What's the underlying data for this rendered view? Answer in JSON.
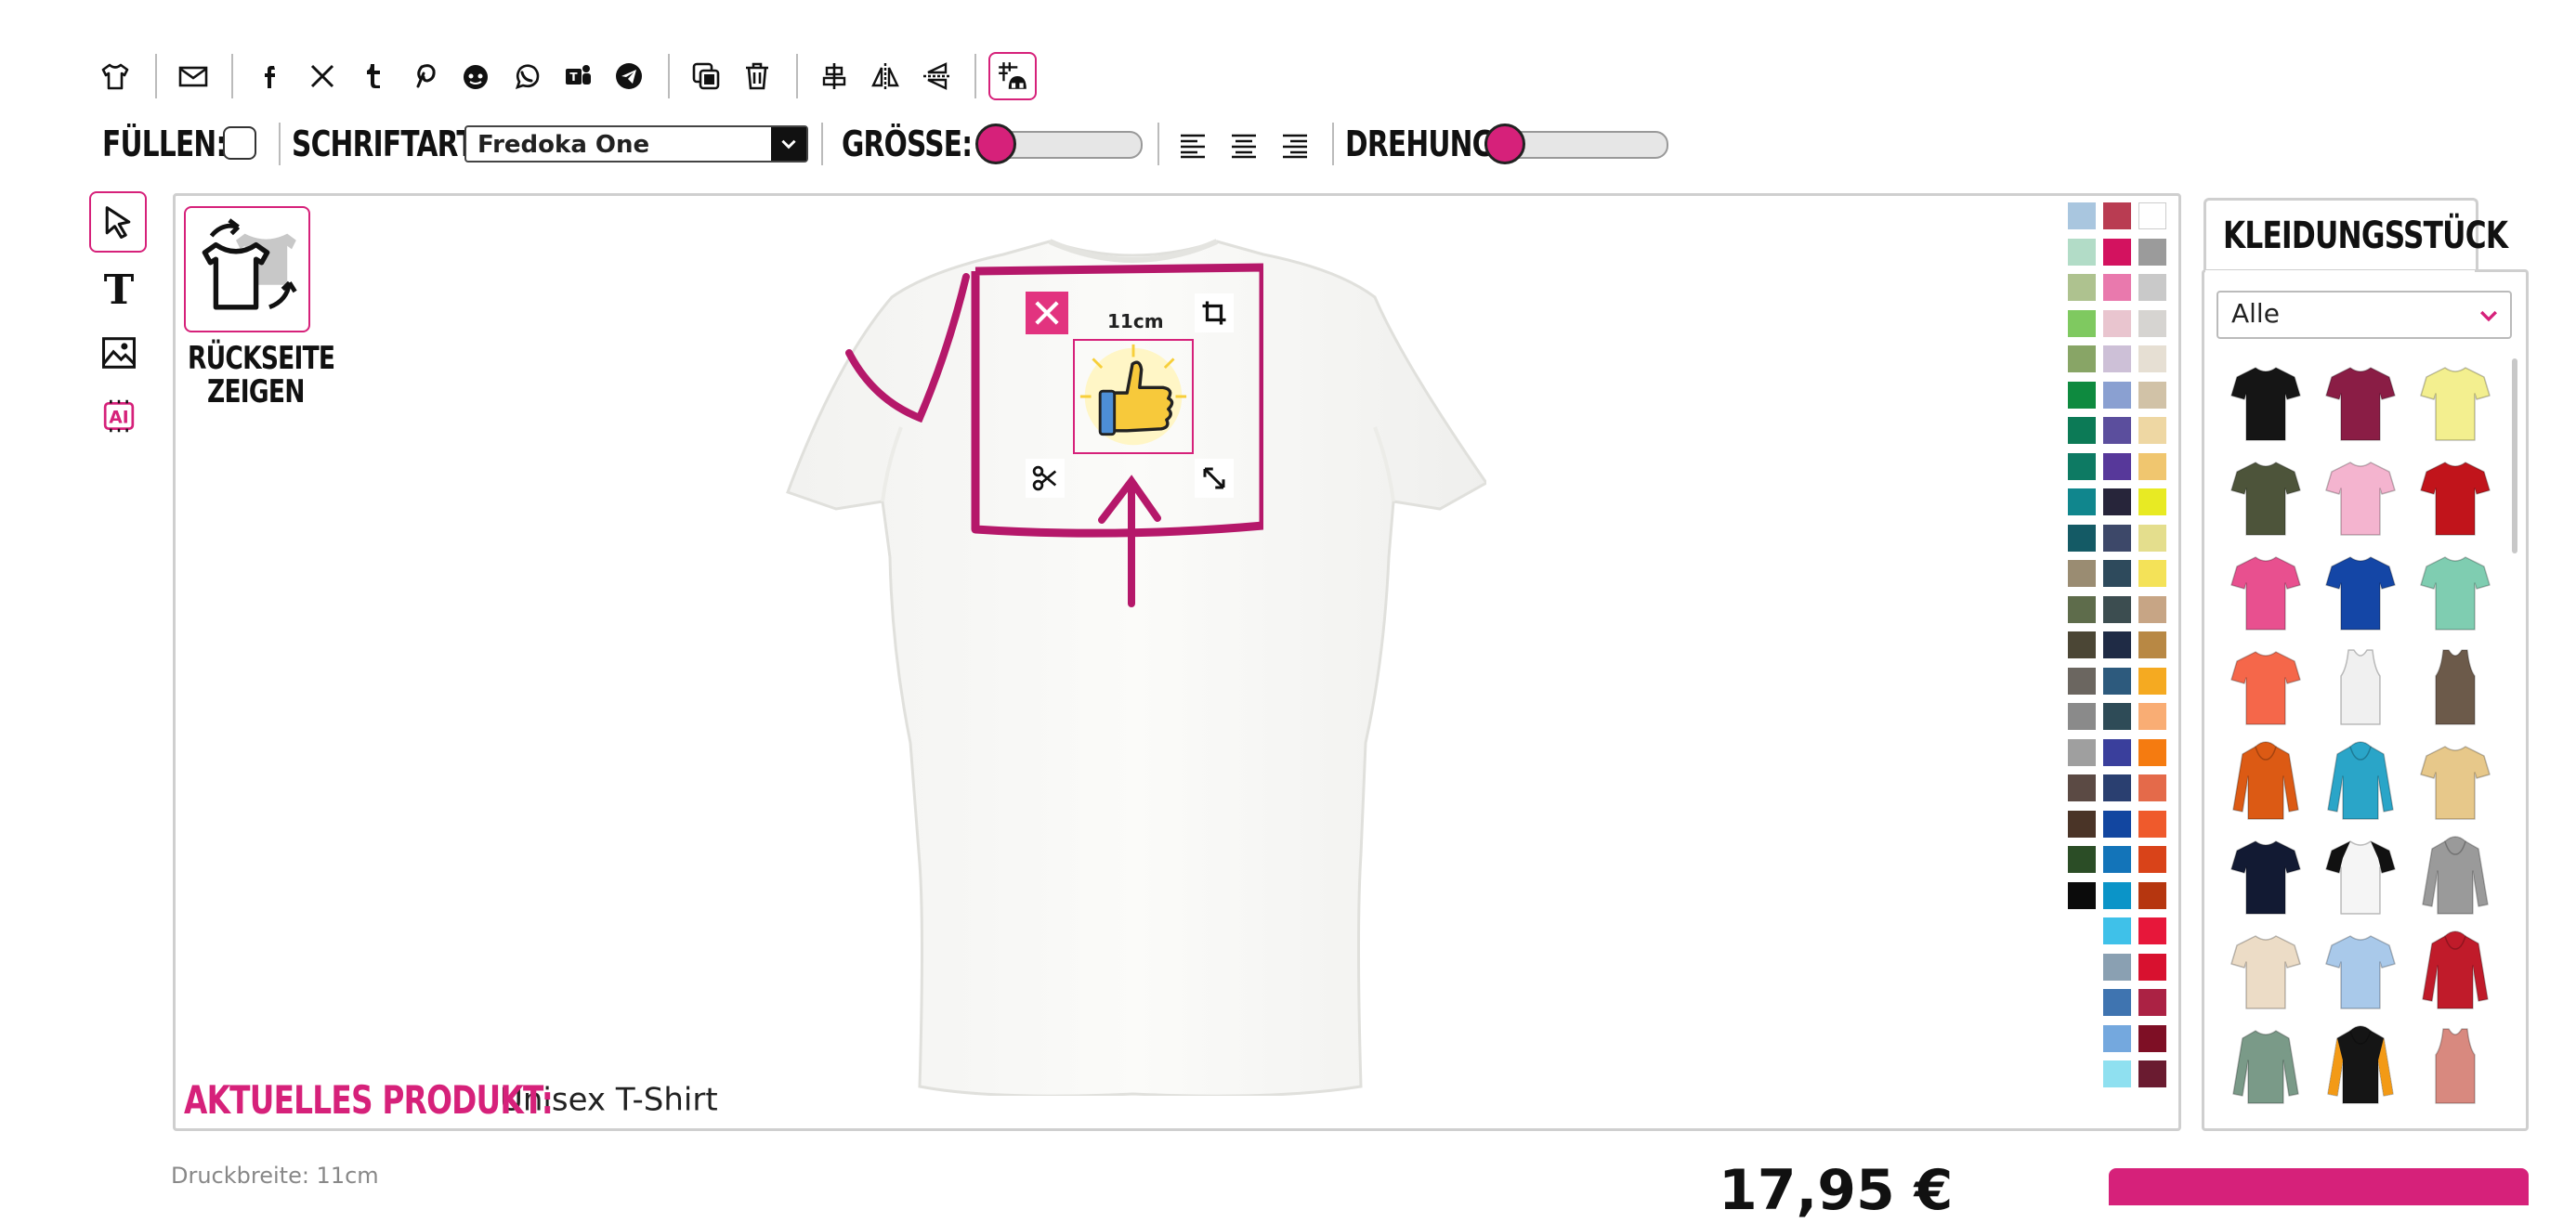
{
  "toolbar": {
    "icons": [
      "shirt-icon",
      "mail-icon",
      "facebook-icon",
      "x-icon",
      "tumblr-icon",
      "pinterest-icon",
      "reddit-icon",
      "whatsapp-icon",
      "teams-icon",
      "telegram-icon",
      "duplicate-icon",
      "delete-icon",
      "align-center-icon",
      "flip-horizontal-icon",
      "flip-vertical-icon",
      "grid-icon"
    ]
  },
  "options": {
    "fill_label": "FÜLLEN:",
    "font_label": "SCHRIFTART:",
    "font_value": "Fredoka One",
    "size_label": "GRÖSSE:",
    "size_level": 0.0,
    "rotation_label": "DREHUNG:",
    "rotation_level": 0.0
  },
  "tools": [
    "pointer-icon",
    "text-icon",
    "image-icon",
    "ai-icon"
  ],
  "back_side": {
    "line1": "RÜCKSEITE",
    "line2": "ZEIGEN"
  },
  "design": {
    "width_label": "11cm"
  },
  "current_product": {
    "label": "AKTUELLES PRODUKT:",
    "value": "Unisex T-Shirt"
  },
  "palette": {
    "col1": [
      "#a9c6df",
      "#b2dcc7",
      "#aec28f",
      "#7fc960",
      "#88a566",
      "#0e8a3f",
      "#0c7a56",
      "#0d7a63",
      "#10868d",
      "#145a65",
      "#9a8c72",
      "#5e6c4b",
      "#4b4635",
      "#6b6660",
      "#8a8a8a",
      "#9f9f9f",
      "#5b4a44",
      "#4a3427",
      "#2b4d26",
      "#0b0b0b"
    ],
    "col2": [
      "#b93c52",
      "#d3125f",
      "#e979ad",
      "#e9c5cf",
      "#cdc0d7",
      "#8aa0d1",
      "#5b4e9d",
      "#57389a",
      "#27253a",
      "#3d4869",
      "#2e4a5c",
      "#3c4d50",
      "#1f2b45",
      "#2d5a7d",
      "#2e4b57",
      "#3a3f9c",
      "#2a3f70",
      "#1246a0",
      "#1374b9",
      "#0b94c8",
      "#3fc1e9",
      "#8aa0b2",
      "#3f74b0",
      "#74a8de",
      "#8fe0f0"
    ],
    "col3": [
      "#ffffff",
      "#9b9b9b",
      "#c9c9c9",
      "#d6d4d1",
      "#e6dfd3",
      "#d1c2a7",
      "#eed7a3",
      "#f0c66f",
      "#e8ea23",
      "#e4de8d",
      "#f4e258",
      "#c7a585",
      "#b88844",
      "#f5aa21",
      "#f9ad74",
      "#f57b10",
      "#e46a4a",
      "#ef5a2c",
      "#d94319",
      "#b6360f",
      "#e7173a",
      "#d8112f",
      "#ab2244",
      "#7e0f25",
      "#6a1b30"
    ]
  },
  "garments": {
    "tab_label": "KLEIDUNGSSTÜCK",
    "filter_value": "Alle",
    "items": [
      {
        "name": "black-tshirt",
        "color": "#151515"
      },
      {
        "name": "burgundy-tshirt",
        "color": "#8a1d45"
      },
      {
        "name": "yellow-tshirt",
        "color": "#f3ef8f"
      },
      {
        "name": "olive-tshirt",
        "color": "#4d543a"
      },
      {
        "name": "light-pink-tshirt",
        "color": "#f4b4cf"
      },
      {
        "name": "red-tshirt",
        "color": "#c1141b"
      },
      {
        "name": "pink-tshirt",
        "color": "#e8508f"
      },
      {
        "name": "royal-blue-tshirt",
        "color": "#1446a6"
      },
      {
        "name": "mint-tshirt",
        "color": "#7fcdb1"
      },
      {
        "name": "coral-tshirt",
        "color": "#f5674a"
      },
      {
        "name": "white-tank",
        "color": "#f0f0f0"
      },
      {
        "name": "brown-tank",
        "color": "#6c5a4a"
      },
      {
        "name": "orange-hoodie",
        "color": "#dc5a14"
      },
      {
        "name": "turquoise-hoodie",
        "color": "#2aa5c8"
      },
      {
        "name": "tie-dye-tshirt",
        "color": "#e7c88a"
      },
      {
        "name": "navy-tshirt",
        "color": "#121a33"
      },
      {
        "name": "raglan-tshirt",
        "color": "#111111"
      },
      {
        "name": "grey-hoodie",
        "color": "#9a9a9a"
      },
      {
        "name": "cream-tshirt",
        "color": "#ecdcc6"
      },
      {
        "name": "blue-fade-tshirt",
        "color": "#a9c9ea"
      },
      {
        "name": "varsity-jacket",
        "color": "#c01b2a"
      },
      {
        "name": "sage-longsleeve",
        "color": "#7a9a88"
      },
      {
        "name": "black-orange-hoodie",
        "color": "#151515"
      },
      {
        "name": "rose-tank",
        "color": "#d8897f"
      }
    ]
  },
  "footer": {
    "print_width": "Druckbreite: 11cm",
    "price_partial": "17,95 €"
  },
  "colors": {
    "accent": "#d6217a",
    "border": "#cfcfcf"
  }
}
